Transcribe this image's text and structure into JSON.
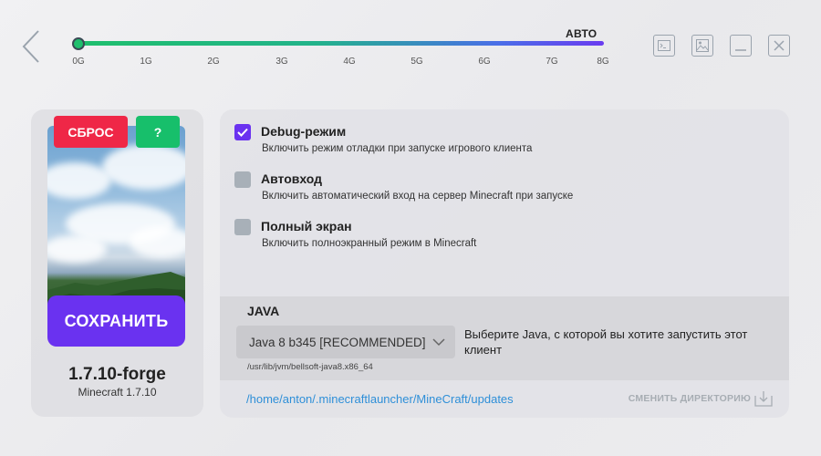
{
  "header": {
    "back_icon": "chevron-left-icon",
    "memory": {
      "auto_label": "АВТО",
      "ticks": [
        "0G",
        "1G",
        "2G",
        "3G",
        "4G",
        "5G",
        "6G",
        "7G",
        "8G"
      ],
      "value_gb": 0
    },
    "window_controls": [
      "console-icon",
      "image-icon",
      "minimize-icon",
      "close-icon"
    ]
  },
  "left_panel": {
    "reset_label": "СБРОС",
    "help_label": "?",
    "save_label": "СОХРАНИТЬ",
    "version_title": "1.7.10-forge",
    "minecraft_version": "Minecraft 1.7.10"
  },
  "options": [
    {
      "title": "Debug-режим",
      "description": "Включить режим отладки при запуске игрового клиента",
      "checked": true
    },
    {
      "title": "Автовход",
      "description": "Включить автоматический вход на сервер Minecraft при запуске",
      "checked": false
    },
    {
      "title": "Полный экран",
      "description": "Включить полноэкранный режим в Minecraft",
      "checked": false
    }
  ],
  "java": {
    "label": "JAVA",
    "selected": "Java 8 b345 [RECOMMENDED]",
    "hint": "Выберите Java, с которой вы хотите запустить этот клиент",
    "path": "/usr/lib/jvm/bellsoft-java8.x86_64"
  },
  "directory": {
    "path": "/home/anton/.minecraftlauncher/MineCraft/updates",
    "change_label": "СМЕНИТЬ ДИРЕКТОРИЮ"
  },
  "colors": {
    "accent": "#6a32f0",
    "reset": "#ef2747",
    "help": "#17bf6b",
    "link": "#2e8fd8"
  }
}
